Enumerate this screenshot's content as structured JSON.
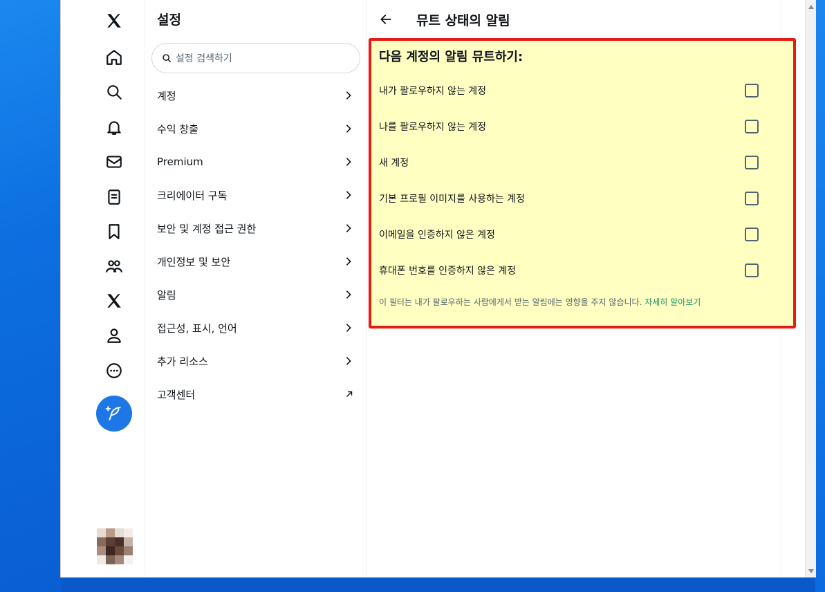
{
  "settings": {
    "title": "설정",
    "search_placeholder": "설정 검색하기",
    "items": [
      {
        "label": "계정",
        "icon": "chevron-right-icon"
      },
      {
        "label": "수익 창출",
        "icon": "chevron-right-icon"
      },
      {
        "label": "Premium",
        "icon": "chevron-right-icon"
      },
      {
        "label": "크리에이터 구독",
        "icon": "chevron-right-icon"
      },
      {
        "label": "보안 및 계정 접근 권한",
        "icon": "chevron-right-icon"
      },
      {
        "label": "개인정보 및 보안",
        "icon": "chevron-right-icon"
      },
      {
        "label": "알림",
        "icon": "chevron-right-icon"
      },
      {
        "label": "접근성, 표시, 언어",
        "icon": "chevron-right-icon"
      },
      {
        "label": "추가 리소스",
        "icon": "chevron-right-icon"
      },
      {
        "label": "고객센터",
        "icon": "external-arrow-icon"
      }
    ]
  },
  "nav": {
    "icons": [
      "x-logo-icon",
      "home-icon",
      "search-icon",
      "bell-icon",
      "mail-icon",
      "list-icon",
      "bookmark-icon",
      "communities-icon",
      "x-premium-icon",
      "profile-icon",
      "more-icon"
    ],
    "compose_icon": "compose-feather-icon",
    "accent": "#1d77e6"
  },
  "main": {
    "title": "뮤트 상태의 알림",
    "section_title": "다음 계정의 알림 뮤트하기:",
    "options": [
      {
        "label": "내가 팔로우하지 않는 계정",
        "checked": false
      },
      {
        "label": "나를 팔로우하지 않는 계정",
        "checked": false
      },
      {
        "label": "새 계정",
        "checked": false
      },
      {
        "label": "기본 프로필 이미지를 사용하는 계정",
        "checked": false
      },
      {
        "label": "이메일을 인증하지 않은 계정",
        "checked": false
      },
      {
        "label": "휴대폰 번호를 인증하지 않은 계정",
        "checked": false
      }
    ],
    "note": "이 필터는 내가 팔로우하는 사람에게서 받는 알림에는 영향을 주지 않습니다.",
    "note_link": "자세히 알아보기",
    "highlight_color": "#e51b14",
    "highlight_fill": "#ffffc2",
    "link_color": "#1a8f6b"
  }
}
